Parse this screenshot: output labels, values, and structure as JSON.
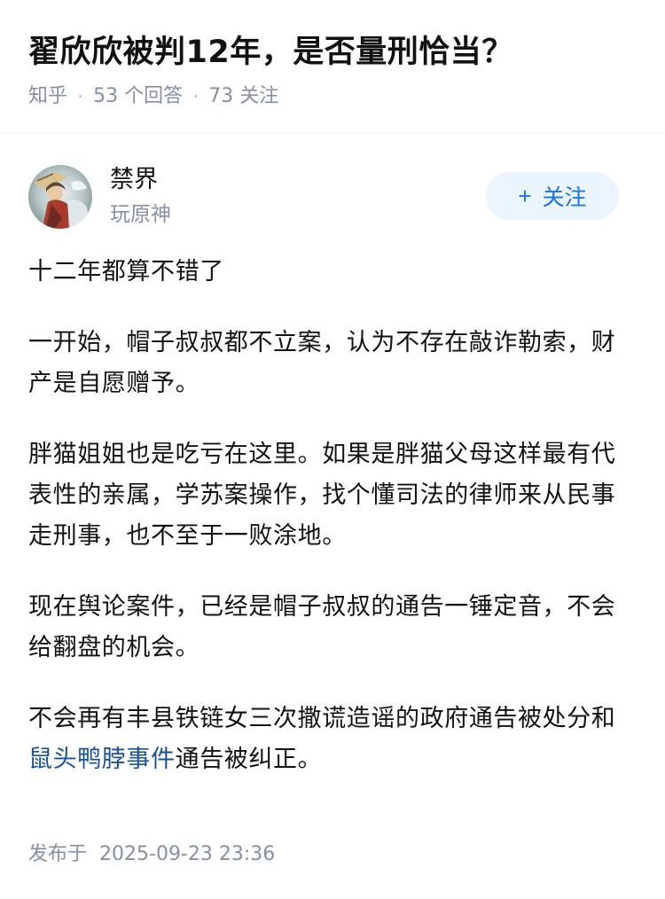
{
  "question": {
    "title": "翟欣欣被判12年，是否量刑恰当？",
    "source": "知乎",
    "answers": "53 个回答",
    "followers": "73 关注"
  },
  "author": {
    "name": "禁界",
    "bio": "玩原神",
    "follow_label": "关注",
    "follow_icon": "plus-icon"
  },
  "answer": {
    "p1": "十二年都算不错了",
    "p2": "一开始，帽子叔叔都不立案，认为不存在敲诈勒索，财产是自愿赠予。",
    "p3": "胖猫姐姐也是吃亏在这里。如果是胖猫父母这样最有代表性的亲属，学苏案操作，找个懂司法的律师来从民事走刑事，也不至于一败涂地。",
    "p4": "现在舆论案件，已经是帽子叔叔的通告一锤定音，不会给翻盘的机会。",
    "p5_before": "不会再有丰县铁链女三次撒谎造谣的政府通告被处分和",
    "p5_link": "鼠头鸭脖事件",
    "p5_after": "通告被纠正。"
  },
  "footer": {
    "label": "发布于",
    "time": "2025-09-23 23:36"
  },
  "colors": {
    "text": "#121212",
    "meta": "#8590a6",
    "link": "#175199",
    "follow_bg": "#ebf5ff",
    "follow_text": "#1772f6"
  }
}
